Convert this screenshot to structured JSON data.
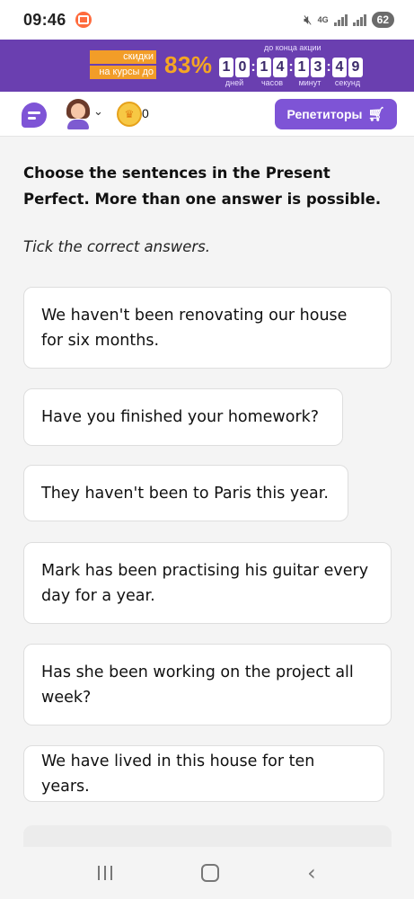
{
  "status_bar": {
    "time": "09:46",
    "network_label": "4G",
    "battery": "62",
    "icons": [
      "recording-icon",
      "mute-icon",
      "signal-icon",
      "battery-icon"
    ]
  },
  "promo": {
    "tag_line1": "скидки",
    "tag_line2": "на курсы до",
    "percent": "83%",
    "until_label": "до конца акции",
    "countdown": {
      "days": [
        "1",
        "0"
      ],
      "hours": [
        "1",
        "4"
      ],
      "minutes": [
        "1",
        "3"
      ],
      "seconds": [
        "4",
        "9"
      ],
      "days_label": "дней",
      "hours_label": "часов",
      "minutes_label": "минут",
      "seconds_label": "секунд"
    }
  },
  "header": {
    "coins": "0",
    "tutors_button_label": "Репетиторы"
  },
  "exercise": {
    "instruction": "Choose the sentences in the Present Perfect. More than one answer is possible.",
    "tick_note": "Tick the correct answers.",
    "options": [
      "We haven't been renovating our house for six months.",
      "Have you finished your homework?",
      "They haven't been to Paris this year.",
      "Mark has been practising his guitar every day for a year.",
      "Has she been working on the project all week?",
      "We have lived in this house for ten years."
    ]
  },
  "colors": {
    "brand_purple": "#7e54d6",
    "banner_purple": "#6a3fb0",
    "promo_orange": "#f29d28"
  }
}
